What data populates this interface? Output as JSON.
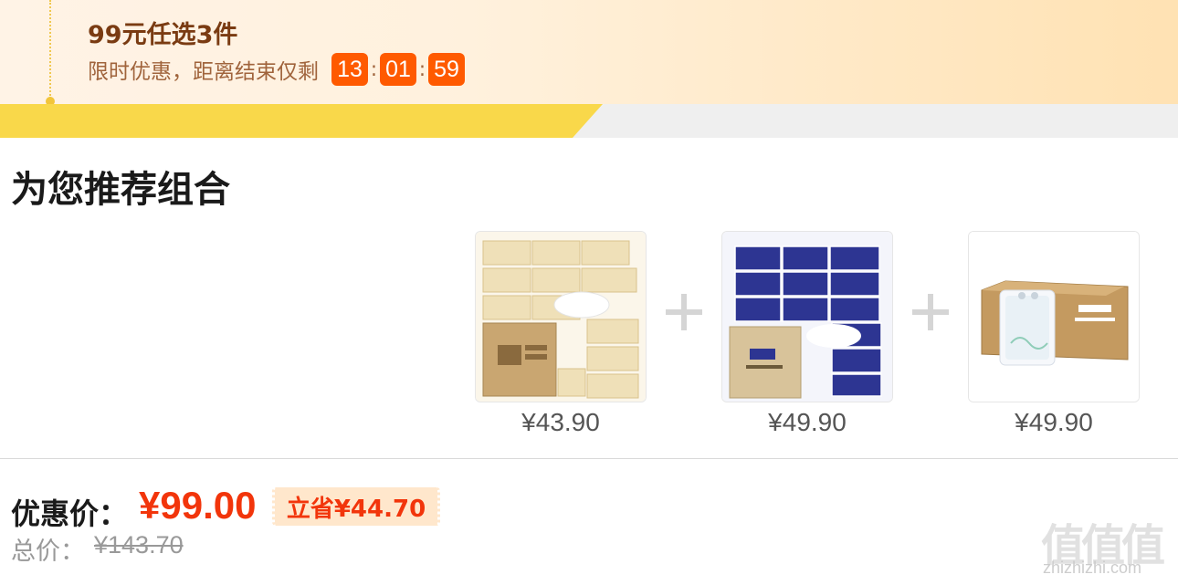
{
  "banner": {
    "title": "99元任选3件",
    "subtitle": "限时优惠，距离结束仅剩",
    "countdown": {
      "hours": "13",
      "minutes": "01",
      "seconds": "59",
      "separator": ":"
    }
  },
  "section": {
    "title": "为您推荐组合"
  },
  "products": [
    {
      "price": "¥43.90"
    },
    {
      "price": "¥49.90"
    },
    {
      "price": "¥49.90"
    }
  ],
  "summary": {
    "deal_label": "优惠价：",
    "deal_price": "¥99.00",
    "save_text": "立省¥44.70",
    "total_label": "总价：",
    "total_price": "¥143.70"
  },
  "watermark": {
    "logo": "值值值",
    "url": "zhizhizhi.com"
  },
  "colors": {
    "accent": "#f2350b",
    "countdown_bg": "#ff5a00",
    "stripe": "#f9d84a",
    "banner_title": "#7a3b12"
  }
}
